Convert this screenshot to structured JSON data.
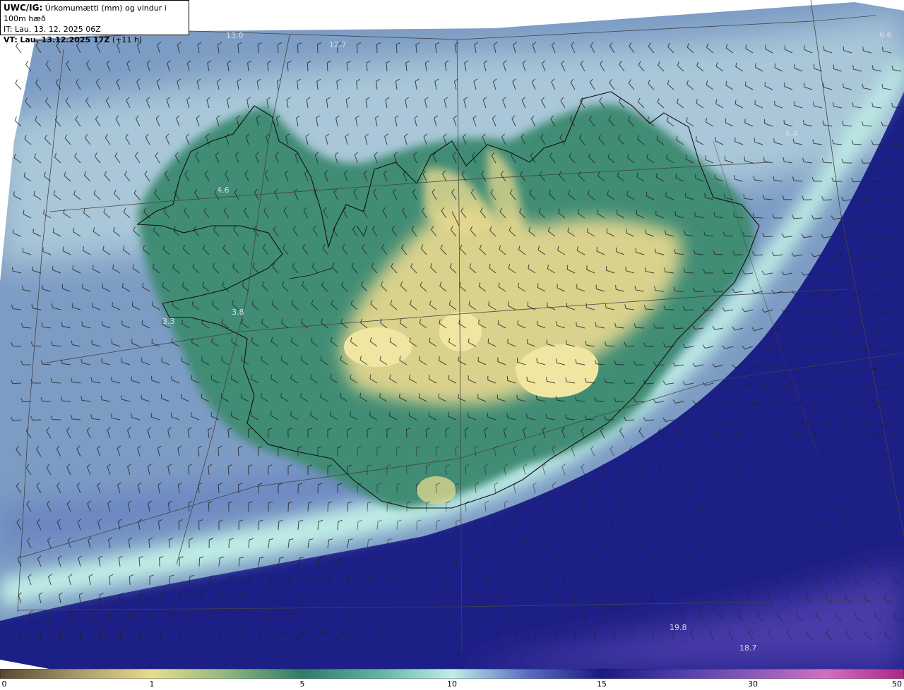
{
  "header": {
    "model": "UWC/IG:",
    "title": "Úrkomumætti (mm) og vindur i 100m hæð",
    "it_line": "IT: Lau. 13. 12. 2025 06Z",
    "vt_prefix": "VT:",
    "vt_value": "Lau. 13.12.2025 17Z",
    "vt_lead": "(+11 h)"
  },
  "map_values": [
    {
      "id": "v1",
      "label": "13.0"
    },
    {
      "id": "v2",
      "label": "12.7"
    },
    {
      "id": "v3",
      "label": "6.6"
    },
    {
      "id": "v4",
      "label": "6.4"
    },
    {
      "id": "v5",
      "label": "4.6"
    },
    {
      "id": "v6",
      "label": "3.8"
    },
    {
      "id": "v7",
      "label": "3.3"
    },
    {
      "id": "v8",
      "label": "19.8"
    },
    {
      "id": "v9",
      "label": "18.7"
    }
  ],
  "colorbar": {
    "ticks": [
      "0",
      "1",
      "5",
      "10",
      "15",
      "30",
      "50"
    ],
    "tick_values": [
      0,
      1,
      5,
      10,
      15,
      30,
      50
    ],
    "stops": [
      {
        "value": 0,
        "color": "#5a4a32"
      },
      {
        "value": 0.5,
        "color": "#a89a6a"
      },
      {
        "value": 1,
        "color": "#e8dc8c"
      },
      {
        "value": 3,
        "color": "#8fb77e"
      },
      {
        "value": 5,
        "color": "#2f7a6a"
      },
      {
        "value": 7.5,
        "color": "#5fb2a2"
      },
      {
        "value": 10,
        "color": "#bfeee6"
      },
      {
        "value": 12.5,
        "color": "#5a6ec0"
      },
      {
        "value": 15,
        "color": "#1a1a80"
      },
      {
        "value": 22,
        "color": "#4a3aa8"
      },
      {
        "value": 30,
        "color": "#8a5ab8"
      },
      {
        "value": 40,
        "color": "#d070c0"
      },
      {
        "value": 50,
        "color": "#b02a8a"
      }
    ]
  },
  "colors": {
    "ocean_nw": "#7d9cc4",
    "ocean_se": "#1c1f86",
    "band_light": "#bfeee6",
    "land_green": "#3f8c74",
    "land_yellow": "#e6d88e",
    "coast": "#111111",
    "grid": "#444444",
    "barb": "#222222"
  }
}
